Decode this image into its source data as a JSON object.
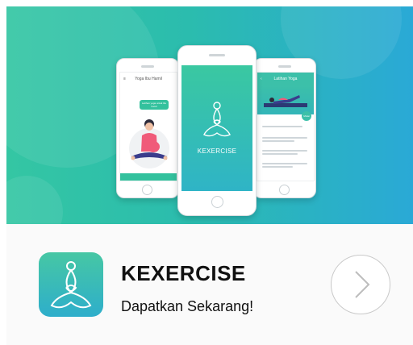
{
  "banner": {
    "left_phone": {
      "header_title": "Yoga Ibu Hamil",
      "speech_bubble": "Latihan yoga untuk ibu hamil"
    },
    "center_phone": {
      "brand_text": "KEXERCISE"
    },
    "right_phone": {
      "header_title": "Latihan Yoga",
      "badge": "Mulai"
    }
  },
  "app": {
    "title": "KEXERCISE",
    "subtitle": "Dapatkan Sekarang!"
  },
  "colors": {
    "gradient_start": "#34c6a3",
    "gradient_end": "#2aa9d6",
    "icon_top": "#46c7a4",
    "icon_bottom": "#2eaecb"
  }
}
